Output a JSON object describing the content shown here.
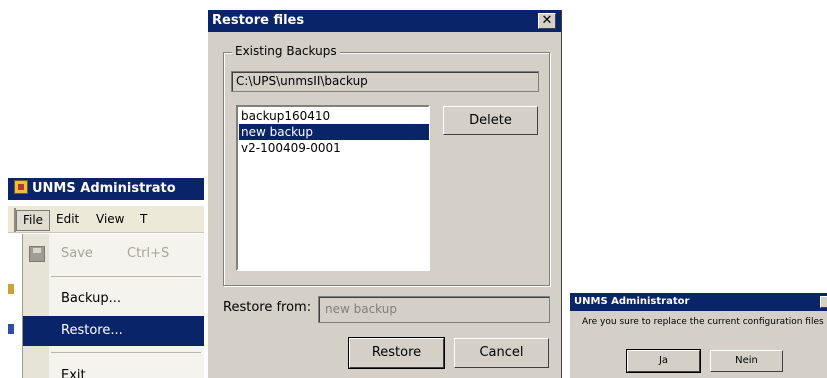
{
  "app": {
    "title": "UNMS Administrato",
    "menubar": {
      "file": "File",
      "edit": "Edit",
      "view": "View",
      "tools": "T"
    },
    "file_menu": {
      "save_label": "Save",
      "save_shortcut": "Ctrl+S",
      "backup_label": "Backup...",
      "restore_label": "Restore...",
      "exit_label": "Exit"
    }
  },
  "dialog": {
    "title": "Restore files",
    "close_glyph": "✕",
    "group_label": "Existing Backups",
    "path": "C:\\UPS\\unmsII\\backup",
    "backups": [
      {
        "label": "backup160410",
        "selected": false
      },
      {
        "label": "new backup",
        "selected": true
      },
      {
        "label": "v2-100409-0001",
        "selected": false
      }
    ],
    "delete_label": "Delete",
    "restore_from_label": "Restore from:",
    "restore_from_value": "new backup",
    "restore_label": "Restore",
    "cancel_label": "Cancel"
  },
  "confirm": {
    "title": "UNMS Administrator",
    "message": "Are you sure to replace the current configuration files",
    "yes_label": "Ja",
    "no_label": "Nein"
  },
  "colors": {
    "titlebar": "#0a246a",
    "dialog_bg": "#d4d0c8",
    "selection": "#0a246a"
  }
}
